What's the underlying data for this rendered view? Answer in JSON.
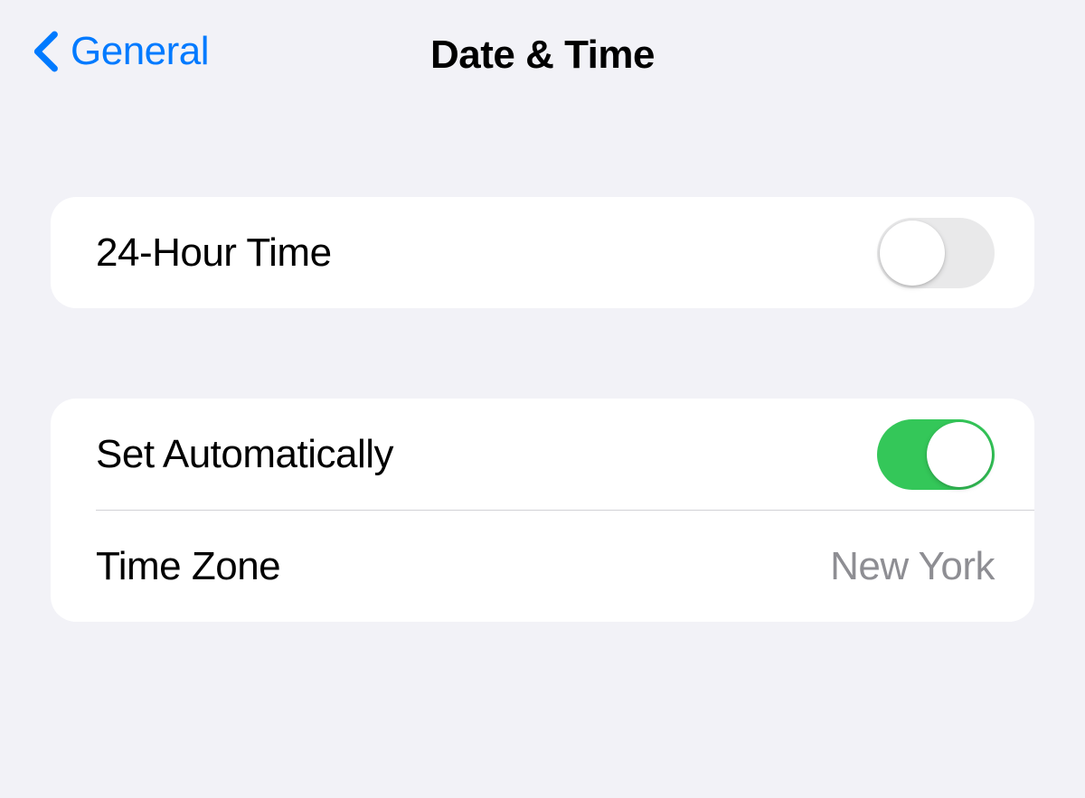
{
  "header": {
    "back_label": "General",
    "title": "Date & Time"
  },
  "groups": [
    {
      "rows": [
        {
          "label": "24-Hour Time",
          "toggle": false
        }
      ]
    },
    {
      "rows": [
        {
          "label": "Set Automatically",
          "toggle": true
        },
        {
          "label": "Time Zone",
          "value": "New York"
        }
      ]
    }
  ]
}
